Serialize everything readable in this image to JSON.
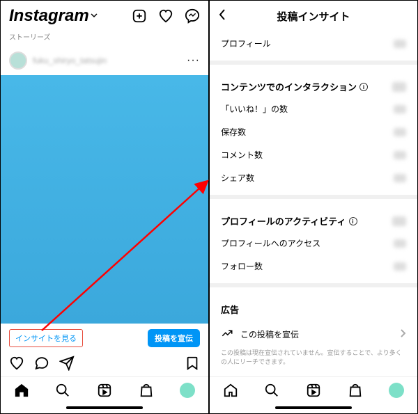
{
  "left": {
    "logo": "Instagram",
    "stories_label": "ストーリーズ",
    "username": "fuku_shiryo_tatsujin",
    "more": "···",
    "insights_link": "インサイトを見る",
    "promote": "投稿を宣伝"
  },
  "right": {
    "title": "投稿インサイト",
    "profile": "プロフィール",
    "interactions_heading": "コンテンツでのインタラクション",
    "likes": "「いいね！」の数",
    "saves": "保存数",
    "comments": "コメント数",
    "shares": "シェア数",
    "activity_heading": "プロフィールのアクティビティ",
    "profile_visits": "プロフィールへのアクセス",
    "follows": "フォロー数",
    "ads_heading": "広告",
    "promote_this": "この投稿を宣伝",
    "ad_desc": "この投稿は現在宣伝されていません。宣伝することで、より多くの人にリーチできます。"
  }
}
